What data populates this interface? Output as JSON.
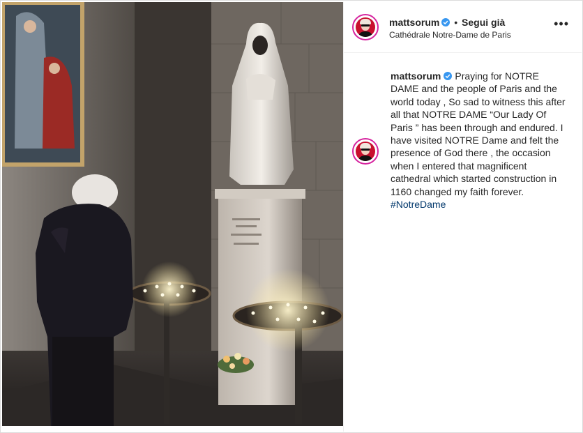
{
  "post": {
    "username": "mattsorum",
    "follow_status": "Segui già",
    "location": "Cathédrale Notre-Dame de Paris",
    "more_label": "•••",
    "caption_text": "Praying for NOTRE DAME and the people of Paris and the world today , So sad to witness this after all that NOTRE DAME “Our Lady Of Paris ” has been through and endured. I have visited NOTRE Dame and felt the presence of God there , the occasion when I entered that magnificent cathedral which started construction in 1160 changed my faith forever.",
    "hashtag": "#NotreDame"
  },
  "icons": {
    "verified": "verified-badge-icon",
    "more": "more-options-icon"
  },
  "colors": {
    "text": "#262626",
    "verified": "#3897f0",
    "hashtag": "#00376b",
    "story_ring": "#d6249f",
    "avatar_bg": "#c8102e"
  }
}
